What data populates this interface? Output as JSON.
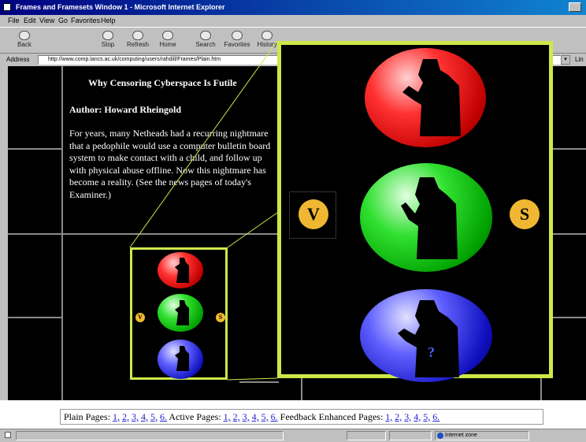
{
  "window": {
    "title": "Frames and Framesets  Window 1 - Microsoft Internet Explorer"
  },
  "menu": [
    "File",
    "Edit",
    "View",
    "Go",
    "Favorites",
    "Help"
  ],
  "toolbar": {
    "back": "Back",
    "stop": "Stop",
    "refresh": "Refresh",
    "home": "Home",
    "search": "Search",
    "favorites": "Favorites",
    "history": "History"
  },
  "address": {
    "label": "Address",
    "value": "http://www.comp.lancs.ac.uk/computing/users/rahdill/Frames/Plain.htm",
    "links_label": "Lin"
  },
  "article": {
    "title": "Why Censoring Cyberspace Is Futile",
    "author": "Author: Howard Rheingold",
    "body": "For years, many Netheads had a recurring nightmare that a pedophile would use a computer bulletin board system to make contact with a child, and follow up with physical abuse offline. Now this nightmare has become a reality. (See the news pages of today's Examiner.)"
  },
  "magnifier": {
    "left_badge": "V",
    "right_badge": "S"
  },
  "thumbnail": {
    "left_badge": "V",
    "right_badge": "S"
  },
  "colors": {
    "highlight": "#cde84a",
    "badge": "#f0b832",
    "link": "#2020d0"
  },
  "bottom_nav": {
    "plain_label": "Plain Pages:",
    "active_label": "Active Pages:",
    "feedback_label": "Feedback Enhanced Pages:",
    "plain_links": [
      "1,",
      "2,",
      "3,",
      "4,",
      "5,",
      "6."
    ],
    "active_links": [
      "1,",
      "2,",
      "3,",
      "4,",
      "5,",
      "6."
    ],
    "feedback_links": [
      "1,",
      "2,",
      "3,",
      "4,",
      "5,",
      "6."
    ]
  },
  "status": {
    "zone": "Internet zone"
  }
}
